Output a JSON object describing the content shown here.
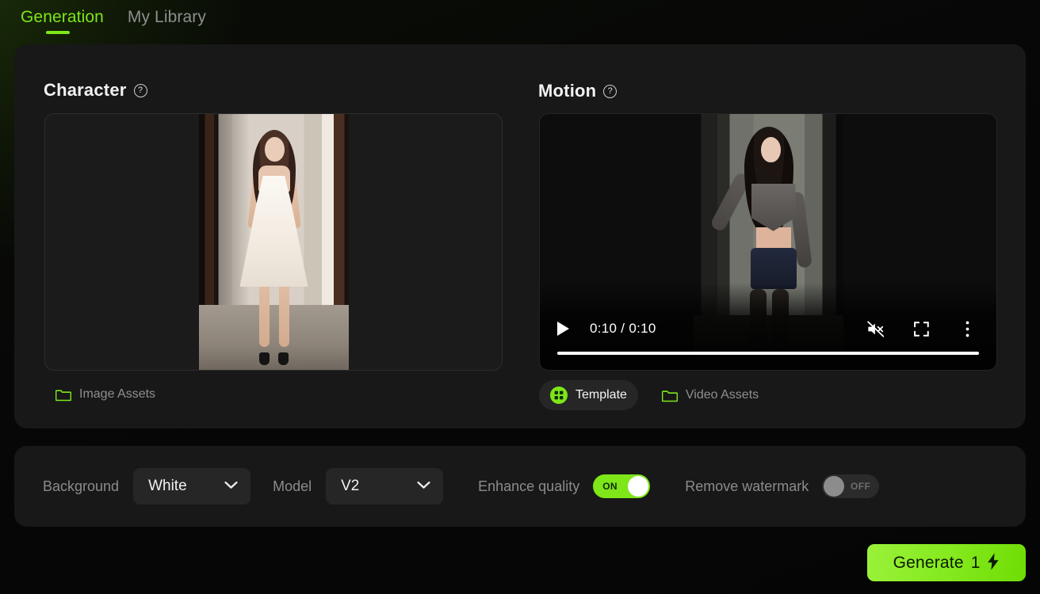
{
  "tabs": [
    {
      "label": "Generation",
      "active": true
    },
    {
      "label": "My Library",
      "active": false
    }
  ],
  "character": {
    "title": "Character",
    "help_icon": "question-circle-icon",
    "assets_button": {
      "label": "Image Assets",
      "icon": "folder-icon",
      "selected": false
    }
  },
  "motion": {
    "title": "Motion",
    "help_icon": "question-circle-icon",
    "player": {
      "play_icon": "play-icon",
      "time": "0:10 / 0:10",
      "current_time": "0:10",
      "duration": "0:10",
      "progress_percent": 100,
      "mute_icon": "volume-muted-icon",
      "fullscreen_icon": "fullscreen-icon",
      "more_icon": "kebab-menu-icon"
    },
    "buttons": [
      {
        "label": "Template",
        "icon": "grid-icon",
        "selected": true
      },
      {
        "label": "Video Assets",
        "icon": "folder-icon",
        "selected": false
      }
    ]
  },
  "settings": {
    "background": {
      "label": "Background",
      "value": "White",
      "chevron": "chevron-down-icon"
    },
    "model": {
      "label": "Model",
      "value": "V2",
      "chevron": "chevron-down-icon"
    },
    "enhance_quality": {
      "label": "Enhance quality",
      "state": "ON",
      "on": true
    },
    "remove_watermark": {
      "label": "Remove watermark",
      "state": "OFF",
      "on": false
    }
  },
  "generate": {
    "label": "Generate",
    "count": "1",
    "icon": "lightning-bolt-icon"
  },
  "colors": {
    "accent_green": "#7ee619",
    "page_bg": "#050505",
    "card_bg": "#181818",
    "muted_text": "#8a8c8a"
  }
}
